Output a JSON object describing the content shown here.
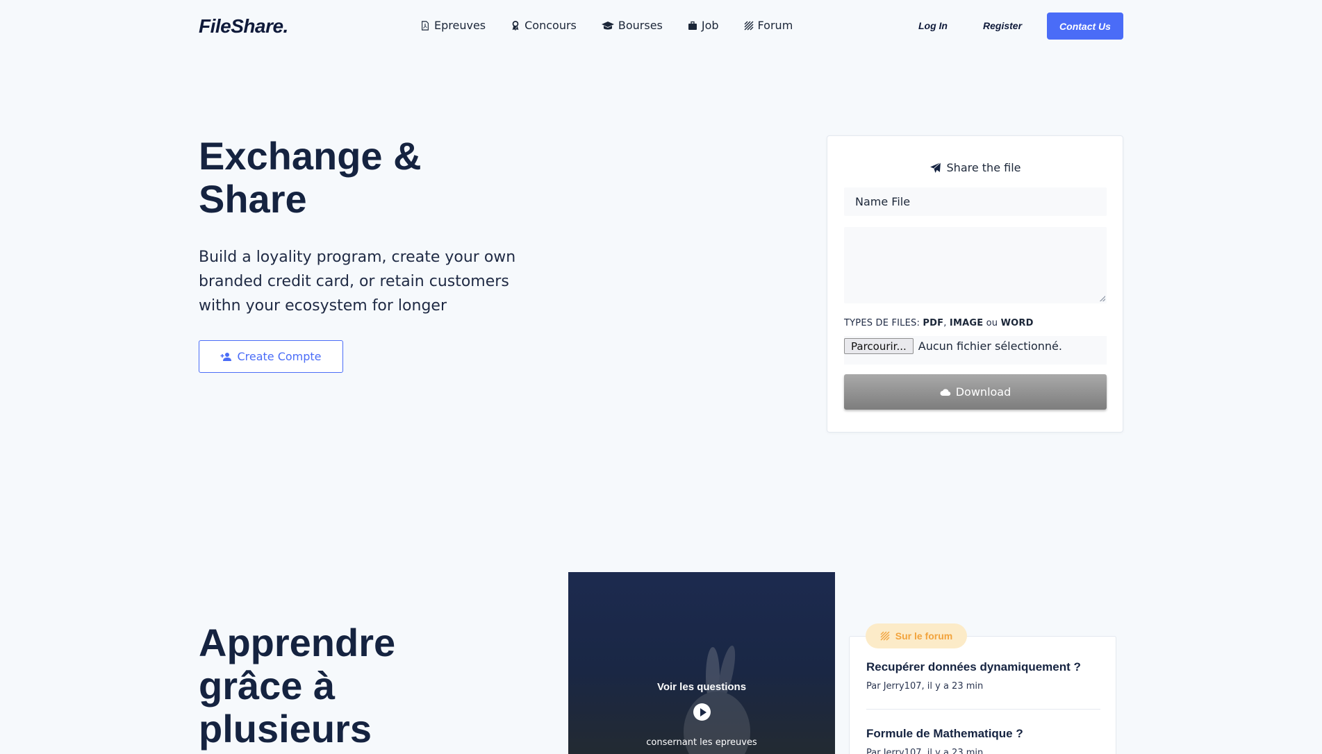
{
  "header": {
    "logo": "FileShare.",
    "nav": [
      {
        "label": "Epreuves",
        "icon": "file-pdf-icon"
      },
      {
        "label": "Concours",
        "icon": "award-ribbon-icon"
      },
      {
        "label": "Bourses",
        "icon": "graduation-cap-icon"
      },
      {
        "label": "Job",
        "icon": "briefcase-icon"
      },
      {
        "label": "Forum",
        "icon": "forum-icon"
      }
    ],
    "login": "Log In",
    "register": "Register",
    "contact": "Contact Us"
  },
  "hero": {
    "title_line1": "Exchange &",
    "title_line2": "Share",
    "description": "Build a loyality program, create your own branded credit card, or retain customers withn your ecosystem for longer",
    "create_button": "Create Compte"
  },
  "upload": {
    "title": "Share the file",
    "name_placeholder": "Name File",
    "types_label": "TYPES DE FILES:",
    "types_pdf": "PDF",
    "types_image": "IMAGE",
    "types_or": "ou",
    "types_word": "WORD",
    "browse_button": "Parcourir...",
    "file_status": "Aucun fichier sélectionné.",
    "download_button": "Download"
  },
  "learn": {
    "title_line1": "Apprendre",
    "title_line2": "grâce à",
    "title_line3": "plusieurs"
  },
  "video": {
    "title": "Voir les questions",
    "subtitle": "consernant les epreuves"
  },
  "forum": {
    "badge": "Sur le forum",
    "items": [
      {
        "question": "Recupérer données dynamiquement ?",
        "meta": "Par Jerry107, il y a 23 min"
      },
      {
        "question": "Formule de Mathematique ?",
        "meta": "Par Jerry107, il y a 23 min"
      }
    ]
  },
  "colors": {
    "accent": "#4a6cf7",
    "navy": "#152340",
    "badge_bg": "#fcebc8",
    "badge_text": "#f2a33c"
  }
}
